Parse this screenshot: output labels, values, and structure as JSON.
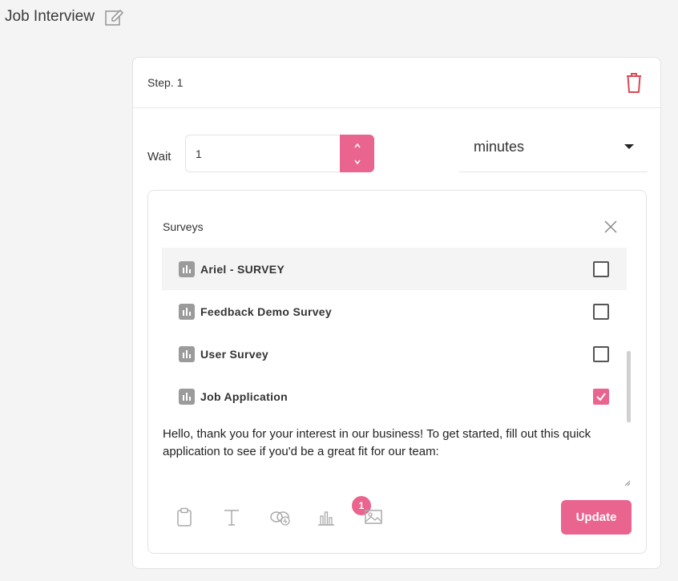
{
  "page": {
    "title": "Job Interview"
  },
  "step": {
    "label": "Step. 1"
  },
  "wait": {
    "label": "Wait",
    "value": "1",
    "unit": "minutes"
  },
  "surveys": {
    "header": "Surveys",
    "items": [
      {
        "name": "Ariel - SURVEY",
        "checked": false
      },
      {
        "name": "Feedback Demo Survey",
        "checked": false
      },
      {
        "name": "User Survey",
        "checked": false
      },
      {
        "name": "Job Application",
        "checked": true
      }
    ]
  },
  "message": {
    "text": "Hello, thank you for your interest in our business! To get started, fill out this quick application to see if you'd be a great fit for our team:"
  },
  "toolbar": {
    "survey_badge_count": "1",
    "update_label": "Update"
  },
  "colors": {
    "accent": "#e9648f",
    "danger": "#d94a55",
    "icon_gray": "#9b9b9b"
  },
  "icons": [
    "edit-icon",
    "trash-icon",
    "close-icon",
    "chevron-up-icon",
    "chevron-down-icon",
    "clipboard-icon",
    "text-icon",
    "link-icon",
    "survey-icon",
    "image-icon"
  ]
}
